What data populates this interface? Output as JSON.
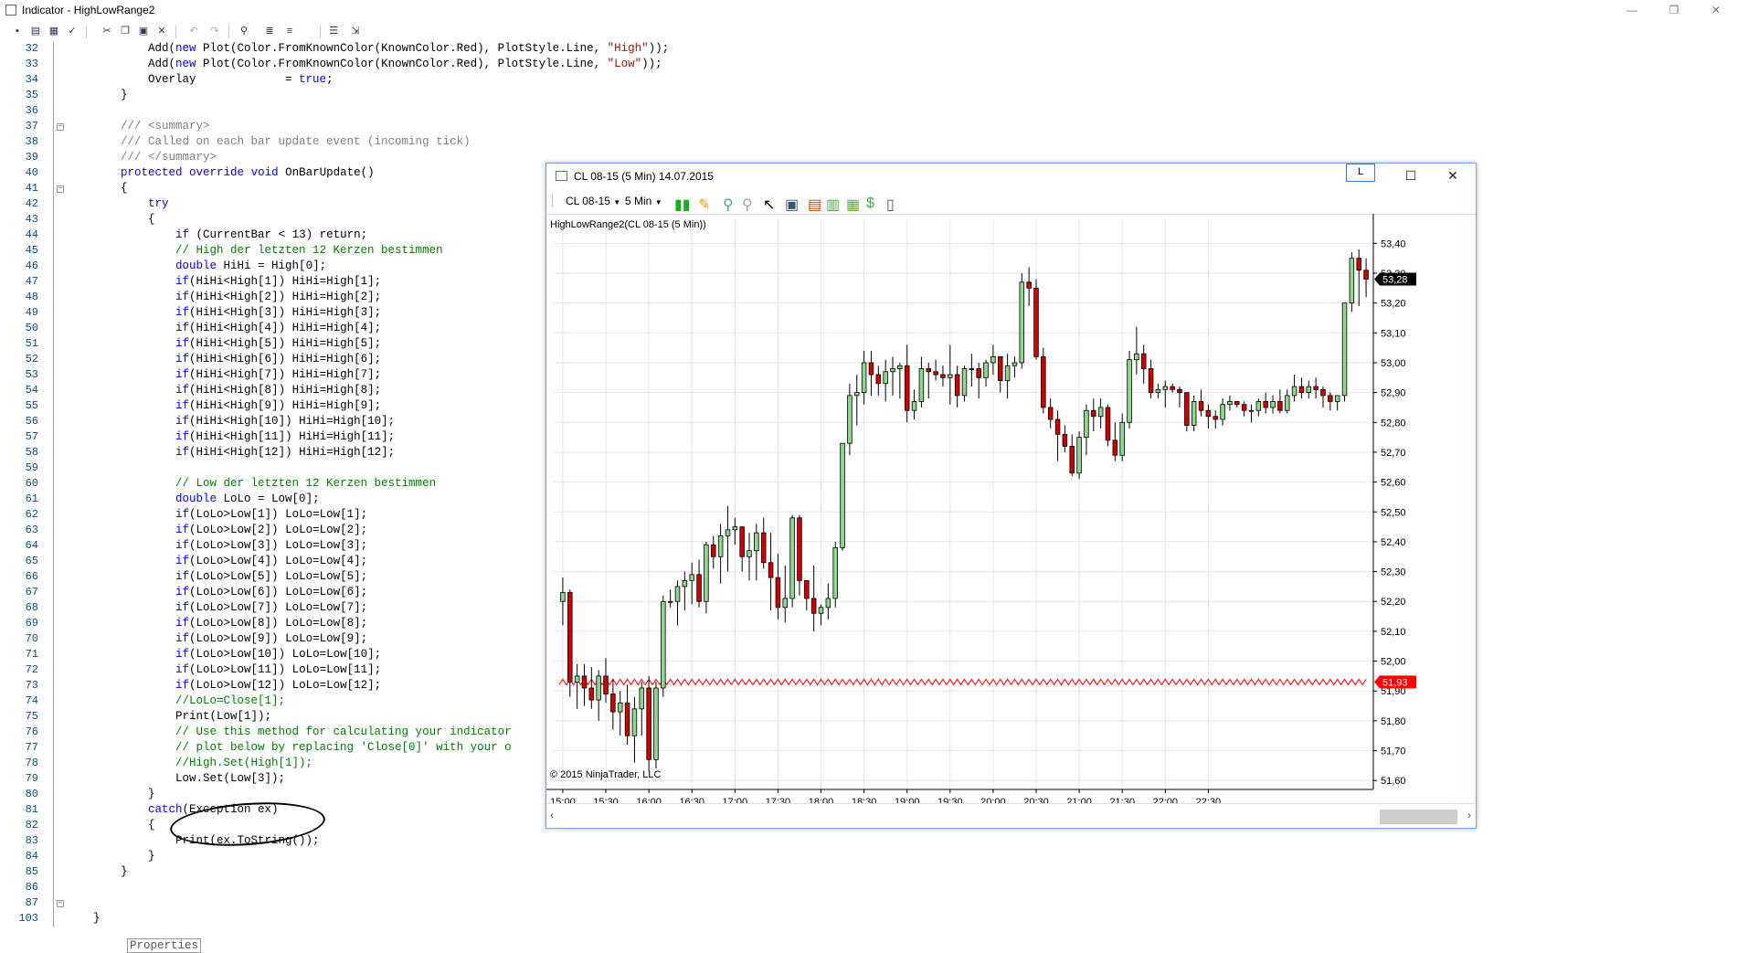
{
  "window": {
    "title": "Indicator - HighLowRange2",
    "minimize": "—",
    "restore": "❐",
    "close": "✕"
  },
  "editor": {
    "lines": [
      {
        "n": "32",
        "text": "            Add(new Plot(Color.FromKnownColor(KnownColor.Red), PlotStyle.Line, \"High\"));"
      },
      {
        "n": "33",
        "text": "            Add(new Plot(Color.FromKnownColor(KnownColor.Red), PlotStyle.Line, \"Low\"));"
      },
      {
        "n": "34",
        "text": "            Overlay             = true;"
      },
      {
        "n": "35",
        "text": "        }"
      },
      {
        "n": "36",
        "text": ""
      },
      {
        "n": "37",
        "text": "        /// <summary>"
      },
      {
        "n": "38",
        "text": "        /// Called on each bar update event (incoming tick)"
      },
      {
        "n": "39",
        "text": "        /// </summary>"
      },
      {
        "n": "40",
        "text": "        protected override void OnBarUpdate()"
      },
      {
        "n": "41",
        "text": "        {"
      },
      {
        "n": "42",
        "text": "            try"
      },
      {
        "n": "43",
        "text": "            {"
      },
      {
        "n": "44",
        "text": "                if (CurrentBar < 13) return;"
      },
      {
        "n": "45",
        "text": "                // High der letzten 12 Kerzen bestimmen"
      },
      {
        "n": "46",
        "text": "                double HiHi = High[0];"
      },
      {
        "n": "47",
        "text": "                if(HiHi<High[1]) HiHi=High[1];"
      },
      {
        "n": "48",
        "text": "                if(HiHi<High[2]) HiHi=High[2];"
      },
      {
        "n": "49",
        "text": "                if(HiHi<High[3]) HiHi=High[3];"
      },
      {
        "n": "50",
        "text": "                if(HiHi<High[4]) HiHi=High[4];"
      },
      {
        "n": "51",
        "text": "                if(HiHi<High[5]) HiHi=High[5];"
      },
      {
        "n": "52",
        "text": "                if(HiHi<High[6]) HiHi=High[6];"
      },
      {
        "n": "53",
        "text": "                if(HiHi<High[7]) HiHi=High[7];"
      },
      {
        "n": "54",
        "text": "                if(HiHi<High[8]) HiHi=High[8];"
      },
      {
        "n": "55",
        "text": "                if(HiHi<High[9]) HiHi=High[9];"
      },
      {
        "n": "56",
        "text": "                if(HiHi<High[10]) HiHi=High[10];"
      },
      {
        "n": "57",
        "text": "                if(HiHi<High[11]) HiHi=High[11];"
      },
      {
        "n": "58",
        "text": "                if(HiHi<High[12]) HiHi=High[12];"
      },
      {
        "n": "59",
        "text": ""
      },
      {
        "n": "60",
        "text": "                // Low der letzten 12 Kerzen bestimmen"
      },
      {
        "n": "61",
        "text": "                double LoLo = Low[0];"
      },
      {
        "n": "62",
        "text": "                if(LoLo>Low[1]) LoLo=Low[1];"
      },
      {
        "n": "63",
        "text": "                if(LoLo>Low[2]) LoLo=Low[2];"
      },
      {
        "n": "64",
        "text": "                if(LoLo>Low[3]) LoLo=Low[3];"
      },
      {
        "n": "65",
        "text": "                if(LoLo>Low[4]) LoLo=Low[4];"
      },
      {
        "n": "66",
        "text": "                if(LoLo>Low[5]) LoLo=Low[5];"
      },
      {
        "n": "67",
        "text": "                if(LoLo>Low[6]) LoLo=Low[6];"
      },
      {
        "n": "68",
        "text": "                if(LoLo>Low[7]) LoLo=Low[7];"
      },
      {
        "n": "69",
        "text": "                if(LoLo>Low[8]) LoLo=Low[8];"
      },
      {
        "n": "70",
        "text": "                if(LoLo>Low[9]) LoLo=Low[9];"
      },
      {
        "n": "71",
        "text": "                if(LoLo>Low[10]) LoLo=Low[10];"
      },
      {
        "n": "72",
        "text": "                if(LoLo>Low[11]) LoLo=Low[11];"
      },
      {
        "n": "73",
        "text": "                if(LoLo>Low[12]) LoLo=Low[12];"
      },
      {
        "n": "74",
        "text": "                //LoLo=Close[1];"
      },
      {
        "n": "75",
        "text": "                Print(Low[1]);"
      },
      {
        "n": "76",
        "text": "                // Use this method for calculating your indicator"
      },
      {
        "n": "77",
        "text": "                // plot below by replacing 'Close[0]' with your o"
      },
      {
        "n": "78",
        "text": "                //High.Set(High[1]);"
      },
      {
        "n": "79",
        "text": "                Low.Set(Low[3]);"
      },
      {
        "n": "80",
        "text": "            }"
      },
      {
        "n": "81",
        "text": "            catch(Exception ex)"
      },
      {
        "n": "82",
        "text": "            {"
      },
      {
        "n": "83",
        "text": "                Print(ex.ToString());"
      },
      {
        "n": "84",
        "text": "            }"
      },
      {
        "n": "85",
        "text": "        }"
      },
      {
        "n": "86",
        "text": ""
      },
      {
        "n": "87",
        "text": "        Properties"
      },
      {
        "n": "103",
        "text": "    }"
      }
    ],
    "properties_label": "Properties"
  },
  "chart_window": {
    "title": "CL 08-15 (5 Min)  14.07.2015",
    "badge": "L",
    "instrument": "CL 08-15",
    "interval": "5 Min",
    "indicator_label": "HighLowRange2(CL 08-15 (5 Min))",
    "copyright": "© 2015 NinjaTrader, LLC"
  },
  "chart_data": {
    "type": "candlestick",
    "xlabels": [
      "15:00",
      "15:30",
      "16:00",
      "16:30",
      "17:00",
      "17:30",
      "18:00",
      "18:30",
      "19:00",
      "19:30",
      "20:00",
      "20:30",
      "21:00",
      "21:30",
      "22:00",
      "22:30"
    ],
    "ylabels": [
      "53,40",
      "53,30",
      "53,20",
      "53,10",
      "53,00",
      "52,90",
      "52,80",
      "52,70",
      "52,60",
      "52,50",
      "52,40",
      "52,30",
      "52,20",
      "52,10",
      "52,00",
      "51,90",
      "51,80",
      "51,70",
      "51,60"
    ],
    "ylim": [
      51.57,
      53.45
    ],
    "last_price": "53,28",
    "indicator_value": "51,93",
    "indicator_value_num": 51.93,
    "up_color": "#8fd68f",
    "down_color": "#d40000",
    "indicator_color": "#ff0000",
    "candles": [
      [
        52.2,
        52.28,
        52.12,
        52.23
      ],
      [
        52.23,
        52.24,
        51.88,
        51.93
      ],
      [
        51.93,
        51.99,
        51.84,
        51.95
      ],
      [
        51.95,
        51.99,
        51.85,
        51.91
      ],
      [
        51.91,
        51.98,
        51.84,
        51.87
      ],
      [
        51.87,
        51.97,
        51.8,
        51.95
      ],
      [
        51.95,
        52.01,
        51.86,
        51.89
      ],
      [
        51.89,
        51.94,
        51.77,
        51.83
      ],
      [
        51.83,
        51.9,
        51.75,
        51.86
      ],
      [
        51.86,
        51.92,
        51.72,
        51.75
      ],
      [
        51.75,
        51.88,
        51.66,
        51.84
      ],
      [
        51.84,
        51.93,
        51.75,
        51.91
      ],
      [
        51.91,
        51.95,
        51.63,
        51.67
      ],
      [
        51.67,
        51.93,
        51.64,
        51.91
      ],
      [
        51.91,
        52.22,
        51.88,
        52.2
      ],
      [
        52.2,
        52.24,
        52.18,
        52.2
      ],
      [
        52.2,
        52.27,
        52.12,
        52.25
      ],
      [
        52.25,
        52.3,
        52.17,
        52.27
      ],
      [
        52.27,
        52.33,
        52.19,
        52.29
      ],
      [
        52.29,
        52.34,
        52.18,
        52.2
      ],
      [
        52.2,
        52.4,
        52.16,
        52.39
      ],
      [
        52.39,
        52.42,
        52.31,
        52.35
      ],
      [
        52.35,
        52.46,
        52.26,
        52.42
      ],
      [
        52.42,
        52.52,
        52.3,
        52.44
      ],
      [
        52.44,
        52.48,
        52.39,
        52.45
      ],
      [
        52.45,
        52.45,
        52.3,
        52.35
      ],
      [
        52.35,
        52.43,
        52.27,
        52.37
      ],
      [
        52.37,
        52.46,
        52.27,
        52.43
      ],
      [
        52.43,
        52.48,
        52.31,
        52.33
      ],
      [
        52.33,
        52.43,
        52.17,
        52.28
      ],
      [
        52.28,
        52.36,
        52.14,
        52.18
      ],
      [
        52.18,
        52.32,
        52.13,
        52.21
      ],
      [
        52.21,
        52.49,
        52.18,
        52.48
      ],
      [
        52.48,
        52.49,
        52.22,
        52.27
      ],
      [
        52.27,
        52.27,
        52.17,
        52.21
      ],
      [
        52.21,
        52.32,
        52.1,
        52.16
      ],
      [
        52.16,
        52.19,
        52.12,
        52.18
      ],
      [
        52.18,
        52.26,
        52.14,
        52.21
      ],
      [
        52.21,
        52.4,
        52.18,
        52.38
      ],
      [
        52.38,
        52.73,
        52.37,
        52.73
      ],
      [
        52.73,
        52.93,
        52.69,
        52.89
      ],
      [
        52.89,
        52.96,
        52.79,
        52.9
      ],
      [
        52.9,
        53.04,
        52.86,
        53.0
      ],
      [
        53.0,
        53.04,
        52.89,
        52.96
      ],
      [
        52.96,
        52.99,
        52.89,
        52.93
      ],
      [
        52.93,
        53.01,
        52.87,
        52.97
      ],
      [
        52.97,
        53.02,
        52.89,
        52.98
      ],
      [
        52.98,
        53.0,
        52.88,
        52.99
      ],
      [
        52.99,
        53.06,
        52.8,
        52.84
      ],
      [
        52.84,
        52.91,
        52.81,
        52.87
      ],
      [
        52.87,
        53.02,
        52.85,
        52.98
      ],
      [
        52.98,
        53.0,
        52.88,
        52.97
      ],
      [
        52.97,
        53.01,
        52.94,
        52.96
      ],
      [
        52.96,
        52.99,
        52.92,
        52.95
      ],
      [
        52.95,
        53.06,
        52.86,
        52.96
      ],
      [
        52.96,
        52.99,
        52.85,
        52.89
      ],
      [
        52.89,
        52.99,
        52.87,
        52.98
      ],
      [
        52.98,
        53.03,
        52.92,
        52.98
      ],
      [
        52.98,
        53.0,
        52.88,
        52.95
      ],
      [
        52.95,
        53.01,
        52.92,
        53.0
      ],
      [
        53.0,
        53.06,
        52.96,
        53.02
      ],
      [
        53.02,
        53.02,
        52.9,
        52.94
      ],
      [
        52.94,
        53.03,
        52.88,
        52.99
      ],
      [
        52.99,
        53.02,
        52.95,
        53.0
      ],
      [
        53.0,
        53.3,
        52.98,
        53.27
      ],
      [
        53.27,
        53.32,
        53.19,
        53.25
      ],
      [
        53.25,
        53.28,
        53.01,
        53.02
      ],
      [
        53.02,
        53.05,
        52.83,
        52.85
      ],
      [
        52.85,
        52.88,
        52.78,
        52.81
      ],
      [
        52.81,
        52.84,
        52.67,
        52.76
      ],
      [
        52.76,
        52.79,
        52.7,
        52.72
      ],
      [
        52.72,
        52.76,
        52.62,
        52.63
      ],
      [
        52.63,
        52.77,
        52.61,
        52.75
      ],
      [
        52.75,
        52.86,
        52.69,
        52.84
      ],
      [
        52.84,
        52.88,
        52.77,
        52.82
      ],
      [
        52.82,
        52.88,
        52.78,
        52.85
      ],
      [
        52.85,
        52.86,
        52.72,
        52.74
      ],
      [
        52.74,
        52.8,
        52.67,
        52.69
      ],
      [
        52.69,
        52.83,
        52.67,
        52.8
      ],
      [
        52.8,
        53.04,
        52.78,
        53.01
      ],
      [
        53.01,
        53.12,
        52.96,
        53.03
      ],
      [
        53.03,
        53.06,
        52.93,
        52.98
      ],
      [
        52.98,
        53.01,
        52.88,
        52.9
      ],
      [
        52.9,
        52.93,
        52.88,
        52.91
      ],
      [
        52.91,
        52.94,
        52.85,
        52.92
      ],
      [
        52.92,
        52.93,
        52.9,
        52.91
      ],
      [
        52.91,
        52.92,
        52.85,
        52.9
      ],
      [
        52.9,
        52.9,
        52.77,
        52.79
      ],
      [
        52.79,
        52.89,
        52.77,
        52.87
      ],
      [
        52.87,
        52.91,
        52.82,
        52.84
      ],
      [
        52.84,
        52.86,
        52.78,
        52.82
      ],
      [
        52.82,
        52.84,
        52.78,
        52.81
      ],
      [
        52.81,
        52.88,
        52.79,
        52.86
      ],
      [
        52.86,
        52.89,
        52.84,
        52.87
      ],
      [
        52.87,
        52.87,
        52.85,
        52.86
      ],
      [
        52.86,
        52.87,
        52.82,
        52.84
      ],
      [
        52.84,
        52.86,
        52.8,
        52.84
      ],
      [
        52.84,
        52.88,
        52.82,
        52.87
      ],
      [
        52.87,
        52.9,
        52.83,
        52.85
      ],
      [
        52.85,
        52.89,
        52.83,
        52.87
      ],
      [
        52.87,
        52.91,
        52.83,
        52.84
      ],
      [
        52.84,
        52.91,
        52.83,
        52.89
      ],
      [
        52.89,
        52.96,
        52.87,
        52.92
      ],
      [
        52.92,
        52.95,
        52.88,
        52.9
      ],
      [
        52.9,
        52.94,
        52.88,
        52.92
      ],
      [
        52.92,
        52.95,
        52.88,
        52.91
      ],
      [
        52.91,
        52.92,
        52.85,
        52.89
      ],
      [
        52.89,
        52.9,
        52.84,
        52.87
      ],
      [
        52.87,
        52.89,
        52.84,
        52.89
      ],
      [
        52.89,
        53.2,
        52.87,
        53.2
      ],
      [
        53.2,
        53.37,
        53.17,
        53.35
      ],
      [
        53.35,
        53.38,
        53.19,
        53.31
      ],
      [
        53.31,
        53.35,
        53.22,
        53.28
      ]
    ]
  }
}
